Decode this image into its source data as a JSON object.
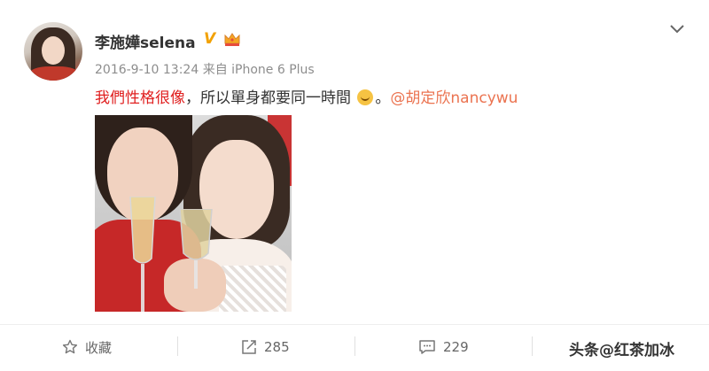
{
  "post": {
    "username": "李施嬅selena",
    "verified_badge": "V",
    "timestamp": "2016-9-10 13:24",
    "source": "来自 iPhone 6 Plus",
    "text_highlight": "我們性格很像",
    "text_rest": "，所以單身都要同一時間",
    "text_end": "。",
    "mention": "@胡定欣nancywu"
  },
  "actions": {
    "favorite_label": "收藏",
    "share_count": "285",
    "comment_count": "229"
  },
  "watermark": "头条@红茶加冰",
  "colors": {
    "highlight": "#e02020",
    "mention": "#eb7350",
    "verified": "#f2a100"
  },
  "icons": {
    "favorite": "star-icon",
    "share": "share-icon",
    "comment": "comment-icon",
    "more": "chevron-down-icon",
    "vip": "crown-icon",
    "emoji": "laugh-emoji-icon"
  }
}
